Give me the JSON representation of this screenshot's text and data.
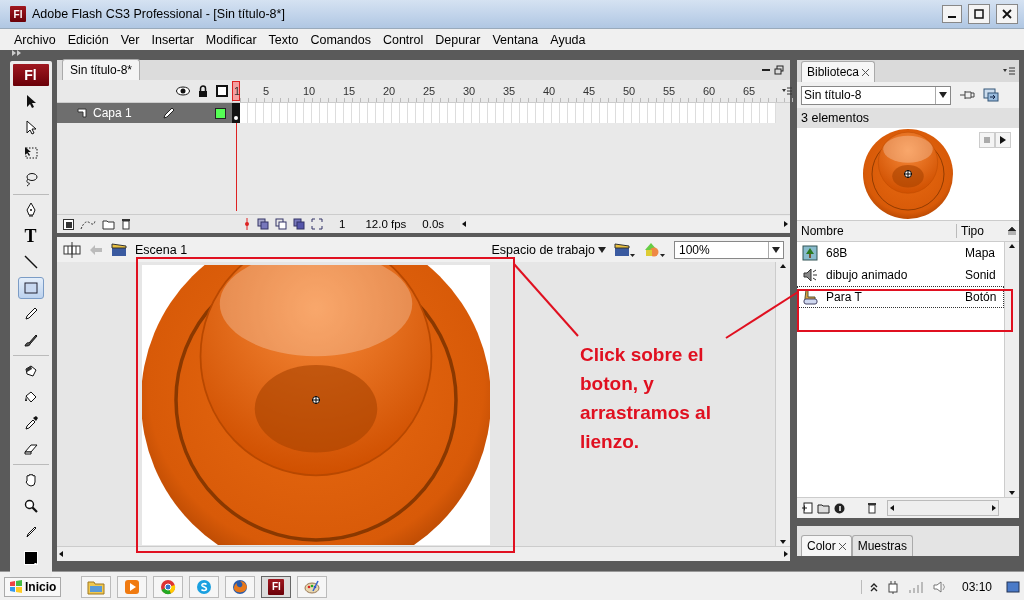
{
  "window": {
    "icon_text": "Fl",
    "title": "Adobe Flash CS3 Professional - [Sin título-8*]"
  },
  "menu": [
    "Archivo",
    "Edición",
    "Ver",
    "Insertar",
    "Modificar",
    "Texto",
    "Comandos",
    "Control",
    "Depurar",
    "Ventana",
    "Ayuda"
  ],
  "tools": {
    "logo": "Fl",
    "groups": [
      [
        {
          "selected": false
        },
        {
          "selected": false
        },
        {
          "selected": false
        },
        {
          "selected": false
        }
      ],
      [
        {
          "selected": false
        },
        {
          "selected": false,
          "glyph": "T"
        },
        {
          "selected": false
        },
        {
          "selected": true
        },
        {
          "selected": false
        },
        {
          "selected": false
        }
      ],
      [
        {
          "selected": false
        },
        {
          "selected": false
        },
        {
          "selected": false
        },
        {
          "selected": false
        }
      ],
      [
        {
          "selected": false
        },
        {
          "selected": false
        },
        {
          "selected": false
        },
        {
          "selected": false
        }
      ]
    ]
  },
  "document": {
    "tab": "Sin título-8*"
  },
  "timeline": {
    "frame_labels": [
      "1",
      "5",
      "10",
      "15",
      "20",
      "25",
      "30",
      "35",
      "40",
      "45",
      "50",
      "55",
      "60",
      "65"
    ],
    "layers": [
      {
        "name": "Capa 1",
        "selected": true
      }
    ],
    "current_frame": "1",
    "frame_rate": "12.0 fps",
    "elapsed": "0.0s"
  },
  "edit_bar": {
    "scene": "Escena 1",
    "workspace": "Espacio de trabajo",
    "zoom": "100%"
  },
  "library": {
    "tab": "Biblioteca",
    "document": "Sin título-8",
    "count": "3 elementos",
    "columns": [
      "Nombre",
      "Tipo"
    ],
    "items": [
      {
        "kind": "bitmap",
        "name": "68B",
        "type": "Mapa",
        "selected": false
      },
      {
        "kind": "sound",
        "name": "dibujo animado",
        "type": "Sonid",
        "selected": false
      },
      {
        "kind": "button",
        "name": "Para T",
        "type": "Botón",
        "selected": true
      }
    ]
  },
  "bottom_panel": {
    "tabs": [
      {
        "label": "Color",
        "selected": true
      },
      {
        "label": "Muestras",
        "selected": false
      }
    ]
  },
  "annotation": {
    "text": "Click sobre el boton, y arrastramos al lienzo."
  },
  "taskbar": {
    "start": "Inicio",
    "apps": [
      {
        "kind": "folder",
        "active": false
      },
      {
        "kind": "media",
        "active": false
      },
      {
        "kind": "chrome",
        "active": false
      },
      {
        "kind": "skype",
        "active": false
      },
      {
        "kind": "firefox",
        "active": false
      },
      {
        "kind": "flash",
        "label": "Fl",
        "active": true
      },
      {
        "kind": "paint",
        "active": false
      }
    ],
    "clock": "03:10"
  }
}
